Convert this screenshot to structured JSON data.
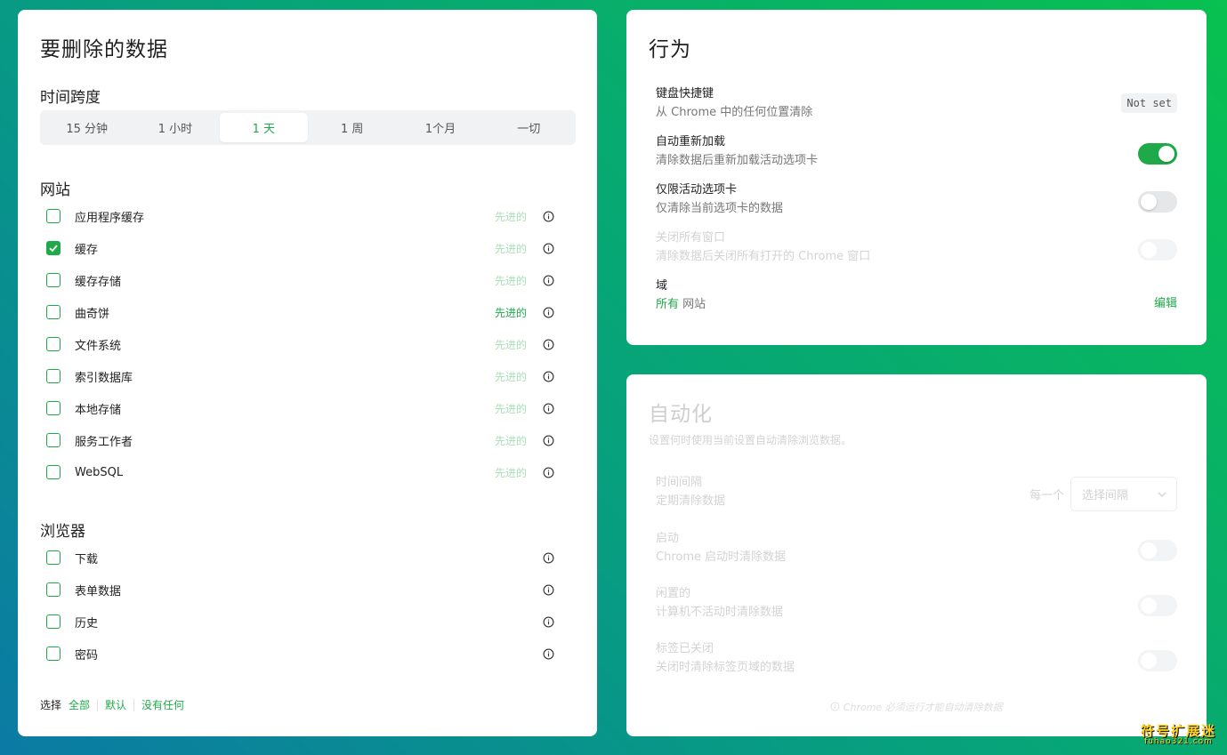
{
  "colors": {
    "accent": "#1faa4a",
    "accent_light": "#a8dfb7",
    "toggle_off": "#e6e7e9"
  },
  "data_panel": {
    "title": "要删除的数据",
    "time_range": {
      "label": "时间跨度",
      "options": [
        "15 分钟",
        "1 小时",
        "1 天",
        "1 周",
        "1个月",
        "一切"
      ],
      "selected": "1 天"
    },
    "websites": {
      "label": "网站",
      "items": [
        {
          "label": "应用程序缓存",
          "tag": "先进的",
          "checked": false
        },
        {
          "label": "缓存",
          "tag": "先进的",
          "checked": true
        },
        {
          "label": "缓存存储",
          "tag": "先进的",
          "checked": false
        },
        {
          "label": "曲奇饼",
          "tag": "先进的",
          "checked": false
        },
        {
          "label": "文件系统",
          "tag": "先进的",
          "checked": false
        },
        {
          "label": "索引数据库",
          "tag": "先进的",
          "checked": false
        },
        {
          "label": "本地存储",
          "tag": "先进的",
          "checked": false
        },
        {
          "label": "服务工作者",
          "tag": "先进的",
          "checked": false
        },
        {
          "label": "WebSQL",
          "tag": "先进的",
          "checked": false
        }
      ]
    },
    "browser": {
      "label": "浏览器",
      "items": [
        {
          "label": "下载",
          "checked": false
        },
        {
          "label": "表单数据",
          "checked": false
        },
        {
          "label": "历史",
          "checked": false
        },
        {
          "label": "密码",
          "checked": false
        }
      ]
    },
    "select_bar": {
      "label": "选择",
      "all": "全部",
      "default": "默认",
      "none": "没有任何"
    }
  },
  "behavior_panel": {
    "title": "行为",
    "shortcut": {
      "title": "键盘快捷键",
      "sub": "从 Chrome 中的任何位置清除",
      "value": "Not set"
    },
    "auto_reload": {
      "title": "自动重新加载",
      "sub": "清除数据后重新加载活动选项卡",
      "on": true
    },
    "active_tab_only": {
      "title": "仅限活动选项卡",
      "sub": "仅清除当前选项卡的数据",
      "on": false
    },
    "close_windows": {
      "title": "关闭所有窗口",
      "sub": "清除数据后关闭所有打开的 Chrome 窗口",
      "on": false
    },
    "domain": {
      "title": "域",
      "sub_highlight": "所有",
      "sub_rest": "网站",
      "edit": "编辑"
    }
  },
  "automation_panel": {
    "title": "自动化",
    "description": "设置何时使用当前设置自动清除浏览数据。",
    "interval": {
      "title": "时间间隔",
      "sub": "定期清除数据",
      "each": "每一个",
      "placeholder": "选择间隔"
    },
    "startup": {
      "title": "启动",
      "sub": "Chrome 启动时清除数据"
    },
    "idle": {
      "title": "闲置的",
      "sub": "计算机不活动时清除数据"
    },
    "tab_closed": {
      "title": "标签已关闭",
      "sub": "关闭时清除标签页域的数据"
    },
    "footer": "Chrome 必须运行才能自动清除数据"
  },
  "watermark": {
    "main": "符号扩展迷",
    "sub": "fuhao321.com"
  }
}
